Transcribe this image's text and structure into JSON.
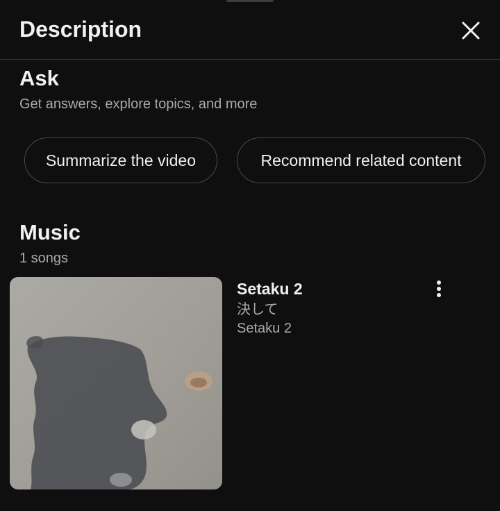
{
  "header": {
    "title": "Description",
    "close_icon": "close-icon"
  },
  "ask": {
    "title": "Ask",
    "subtitle": "Get answers, explore topics, and more",
    "chips": [
      {
        "label": "Summarize the video"
      },
      {
        "label": "Recommend related content"
      }
    ]
  },
  "music": {
    "title": "Music",
    "count": "1 songs",
    "songs": [
      {
        "title": "Setaku 2",
        "line2": "決して",
        "line3": "Setaku 2",
        "thumbnail": "shadow-on-sand-photo",
        "menu_icon": "more-vertical-icon"
      }
    ]
  },
  "colors": {
    "background": "#0f0f0f",
    "primary_text": "#f1f1f1",
    "secondary_text": "#aaaaaa",
    "divider": "#3a3a3a",
    "chip_border": "#4a4a4a"
  }
}
